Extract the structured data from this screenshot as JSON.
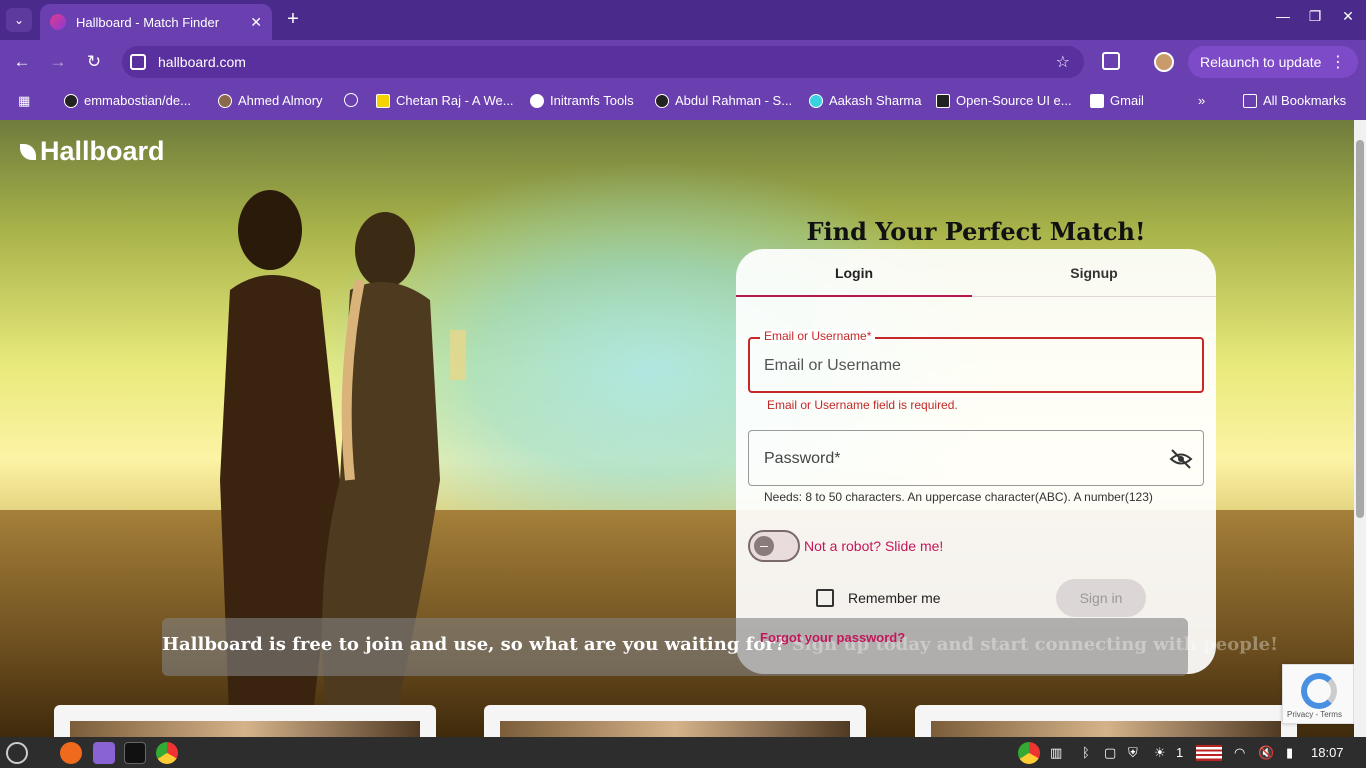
{
  "browser": {
    "tab_title": "Hallboard - Match Finder",
    "url": "hallboard.com",
    "relaunch_label": "Relaunch to update",
    "bookmarks": [
      "emmabostian/de...",
      "Ahmed Almory",
      "Chetan Raj - A We...",
      "Initramfs Tools",
      "Abdul Rahman - S...",
      "Aakash Sharma",
      "Open-Source UI e...",
      "Gmail"
    ],
    "all_bookmarks": "All Bookmarks"
  },
  "site": {
    "brand": "Hallboard",
    "hero_title": "Find Your Perfect Match!",
    "tabs": {
      "login": "Login",
      "signup": "Signup"
    },
    "email": {
      "legend": "Email or Username*",
      "placeholder": "Email or Username",
      "error": "Email or Username field is required."
    },
    "password": {
      "placeholder": "Password*",
      "hint": "Needs: 8 to 50 characters. An uppercase character(ABC). A number(123)"
    },
    "robot_label": "Not a robot? Slide me!",
    "remember_label": "Remember me",
    "signin_label": "Sign in",
    "forgot_label": "Forgot your password?",
    "banner_text_a": "Hallboard is free to join and use, so what are you waiting for?",
    "banner_text_b": "Sign up today and start connecting with people!",
    "recaptcha_links": "Privacy - Terms"
  },
  "taskbar": {
    "time": "18:07",
    "notif_count": "1"
  },
  "colors": {
    "accent": "#b0184e",
    "error": "#c62828",
    "link": "#c2185b",
    "browser": "#6a3fb0"
  }
}
